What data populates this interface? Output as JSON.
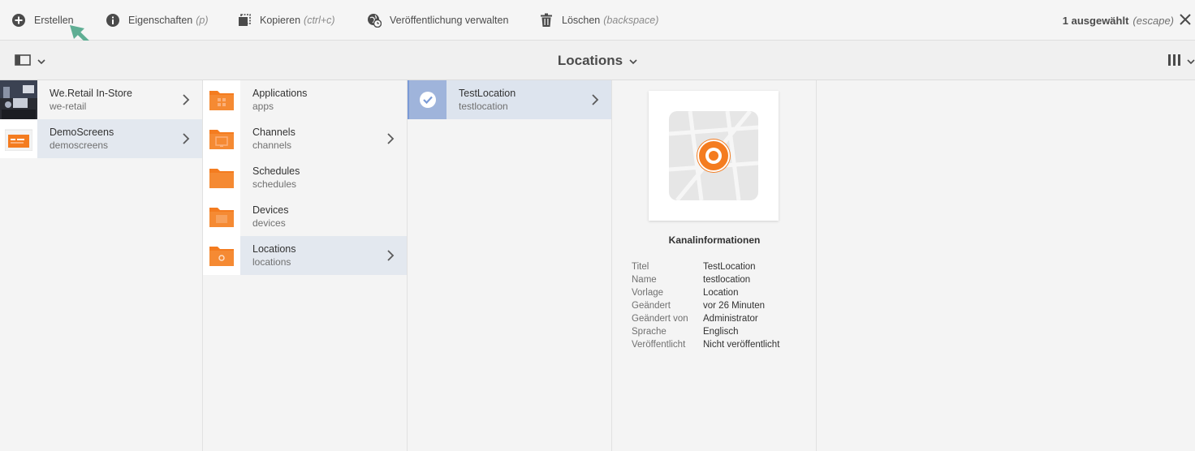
{
  "actionbar": {
    "create_label": "Erstellen",
    "properties_label": "Eigenschaften",
    "properties_hint": "(p)",
    "copy_label": "Kopieren",
    "copy_hint": "(ctrl+c)",
    "publish_label": "Veröffentlichung verwalten",
    "delete_label": "Löschen",
    "delete_hint": "(backspace)",
    "selected_count": "1 ausgewählt",
    "selected_hint": "(escape)"
  },
  "titlebar": {
    "title": "Locations"
  },
  "columns": {
    "col1": [
      {
        "title": "We.Retail In-Store",
        "subtitle": "we-retail"
      },
      {
        "title": "DemoScreens",
        "subtitle": "demoscreens"
      }
    ],
    "col2": [
      {
        "title": "Applications",
        "subtitle": "apps"
      },
      {
        "title": "Channels",
        "subtitle": "channels"
      },
      {
        "title": "Schedules",
        "subtitle": "schedules"
      },
      {
        "title": "Devices",
        "subtitle": "devices"
      },
      {
        "title": "Locations",
        "subtitle": "locations"
      }
    ],
    "col3": [
      {
        "title": "TestLocation",
        "subtitle": "testlocation"
      }
    ]
  },
  "details": {
    "heading": "Kanalinformationen",
    "rows": [
      {
        "key": "Titel",
        "value": "TestLocation"
      },
      {
        "key": "Name",
        "value": "testlocation"
      },
      {
        "key": "Vorlage",
        "value": "Location"
      },
      {
        "key": "Geändert",
        "value": "vor 26 Minuten"
      },
      {
        "key": "Geändert von",
        "value": "Administrator"
      },
      {
        "key": "Sprache",
        "value": "Englisch"
      },
      {
        "key": "Veröffentlicht",
        "value": "Nicht veröffentlicht"
      }
    ]
  },
  "colors": {
    "folder": "#f47c20",
    "accent": "#7a9ad6",
    "pointer": "#5fae94"
  }
}
